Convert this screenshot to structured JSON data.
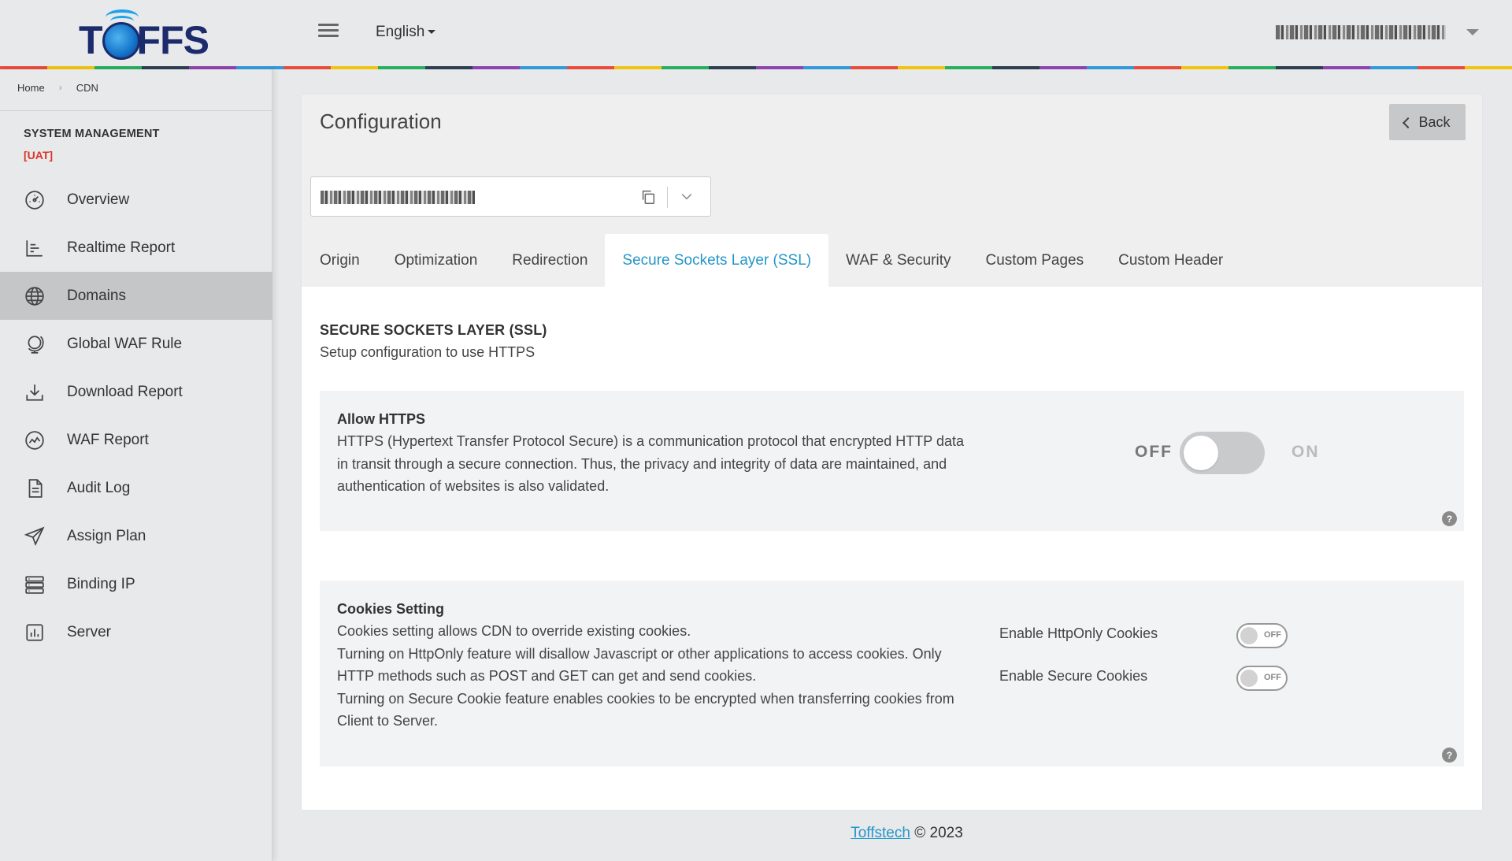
{
  "header": {
    "logo_text": "TOFFS",
    "language": "English"
  },
  "breadcrumb": {
    "home": "Home",
    "current": "CDN"
  },
  "sidebar": {
    "title": "SYSTEM MANAGEMENT",
    "env": "[UAT]",
    "items": [
      {
        "label": "Overview",
        "icon": "dashboard-gauge-icon"
      },
      {
        "label": "Realtime Report",
        "icon": "bar-chart-icon"
      },
      {
        "label": "Domains",
        "icon": "globe-icon",
        "active": true
      },
      {
        "label": "Global WAF Rule",
        "icon": "globe-stand-icon"
      },
      {
        "label": "Download Report",
        "icon": "download-icon"
      },
      {
        "label": "WAF Report",
        "icon": "shield-chart-icon"
      },
      {
        "label": "Audit Log",
        "icon": "document-icon"
      },
      {
        "label": "Assign Plan",
        "icon": "paper-plane-icon"
      },
      {
        "label": "Binding IP",
        "icon": "server-rack-icon"
      },
      {
        "label": "Server",
        "icon": "server-chart-icon"
      }
    ]
  },
  "main": {
    "title": "Configuration",
    "back_label": "Back",
    "tabs": [
      {
        "label": "Origin"
      },
      {
        "label": "Optimization"
      },
      {
        "label": "Redirection"
      },
      {
        "label": "Secure Sockets Layer (SSL)",
        "active": true
      },
      {
        "label": "WAF & Security"
      },
      {
        "label": "Custom Pages"
      },
      {
        "label": "Custom Header"
      }
    ],
    "section_title": "SECURE SOCKETS LAYER (SSL)",
    "section_subtitle": "Setup configuration to use HTTPS",
    "https_card": {
      "title": "Allow HTTPS",
      "description": "HTTPS (Hypertext Transfer Protocol Secure) is a communication protocol that encrypted HTTP data in transit through a secure connection. Thus, the privacy and integrity of data are maintained, and authentication of websites is also validated.",
      "off_label": "OFF",
      "on_label": "ON",
      "enabled": false,
      "help": "?"
    },
    "cookies_card": {
      "title": "Cookies Setting",
      "description_lines": [
        "Cookies setting allows CDN to override existing cookies.",
        "Turning on HttpOnly feature will disallow Javascript or other applications to access cookies. Only HTTP methods such as POST and GET can get and send cookies.",
        "Turning on Secure Cookie feature enables cookies to be encrypted when transferring cookies from Client to Server."
      ],
      "options": [
        {
          "label": "Enable HttpOnly Cookies",
          "state": "OFF"
        },
        {
          "label": "Enable Secure Cookies",
          "state": "OFF"
        }
      ],
      "help": "?"
    }
  },
  "footer": {
    "link": "Toffstech",
    "text": "© 2023"
  }
}
